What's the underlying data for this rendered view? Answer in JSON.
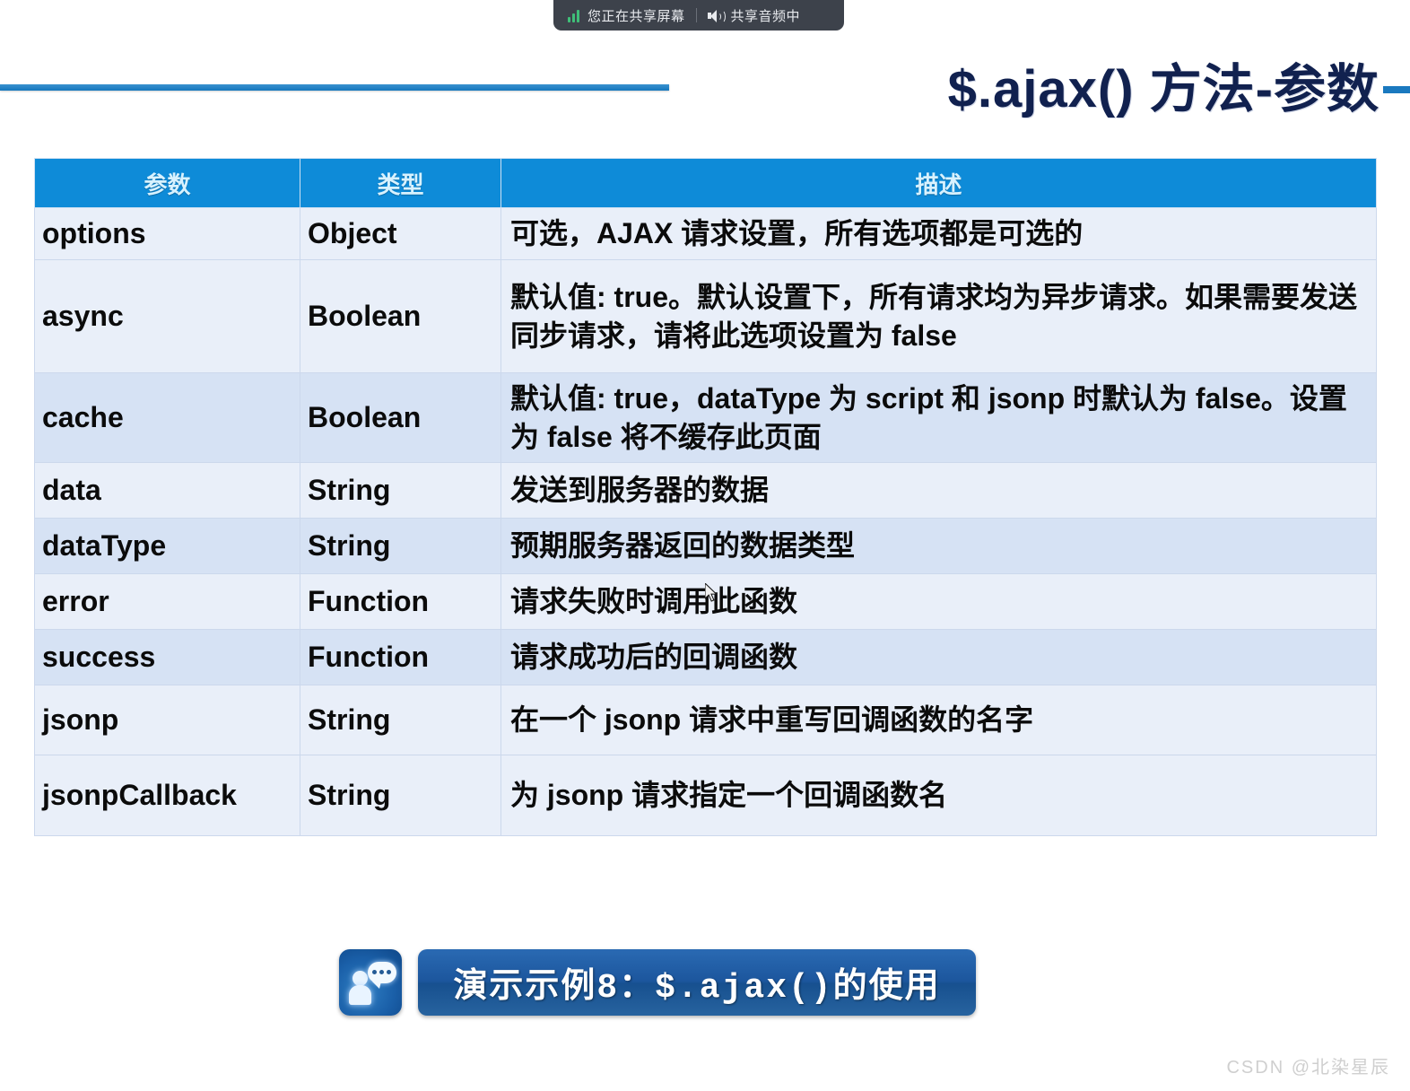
{
  "share_banner": {
    "screen_text": "您正在共享屏幕",
    "audio_text": "共享音频中",
    "signal_icon": "signal-bars-icon",
    "speaker_icon": "speaker-icon",
    "background_color": "#3d424b",
    "accent_color": "#3fbf78"
  },
  "header": {
    "title": "$.ajax() 方法-参数",
    "title_color": "#11214f",
    "rule_color": "#1577bd"
  },
  "table": {
    "header_bg": "#0e8bd8",
    "header_text_color": "#d8f2ff",
    "row_odd_bg": "#e9eff9",
    "row_even_bg": "#d6e2f4",
    "columns": [
      "参数",
      "类型",
      "描述"
    ],
    "rows": [
      {
        "param": "options",
        "type": "Object",
        "desc": "可选，AJAX 请求设置，所有选项都是可选的"
      },
      {
        "param": "async",
        "type": "Boolean",
        "desc": "默认值: true。默认设置下，所有请求均为异步请求。如果需要发送同步请求，请将此选项设置为 false"
      },
      {
        "param": "cache",
        "type": "Boolean",
        "desc": "默认值: true，dataType 为 script 和 jsonp 时默认为 false。设置为 false 将不缓存此页面"
      },
      {
        "param": "data",
        "type": "String",
        "desc": "发送到服务器的数据"
      },
      {
        "param": "dataType",
        "type": "String",
        "desc": "预期服务器返回的数据类型"
      },
      {
        "param": "error",
        "type": "Function",
        "desc": "请求失败时调用此函数"
      },
      {
        "param": "success",
        "type": "Function",
        "desc": "请求成功后的回调函数"
      },
      {
        "param": "jsonp",
        "type": "String",
        "desc": "在一个 jsonp 请求中重写回调函数的名字"
      },
      {
        "param": "jsonpCallback",
        "type": "String",
        "desc": "为 jsonp 请求指定一个回调函数名"
      }
    ]
  },
  "demo": {
    "icon": "person-speech-bubble-icon",
    "label": "演示示例8：$.ajax()的使用",
    "banner_color": "#1c569d"
  },
  "watermark": {
    "text": "CSDN @北染星辰"
  }
}
